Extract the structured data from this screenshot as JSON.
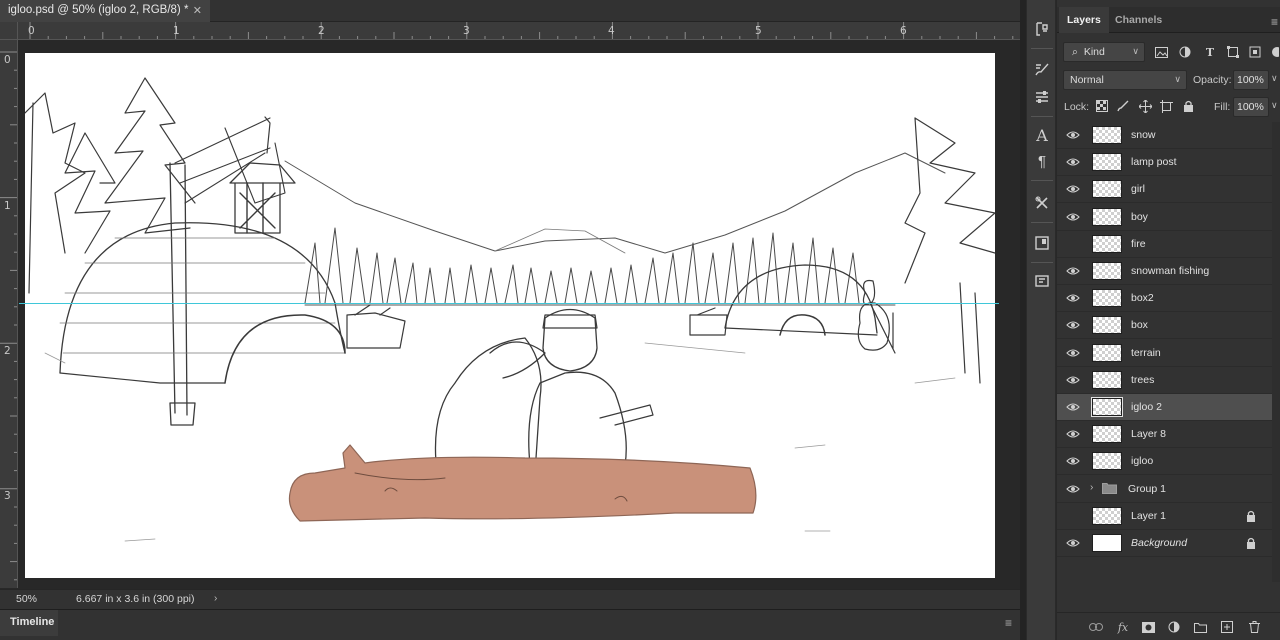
{
  "document": {
    "tab_title": "igloo.psd @ 50% (igloo 2, RGB/8) *",
    "close_glyph": "✕"
  },
  "rulers": {
    "horizontal": [
      "0",
      "1",
      "2",
      "3",
      "4",
      "5",
      "6"
    ],
    "vertical": [
      "0",
      "1",
      "2",
      "3"
    ]
  },
  "status": {
    "zoom": "50%",
    "doc_info": "6.667 in x 3.6 in (300 ppi)",
    "arrow": "›"
  },
  "timeline": {
    "label": "Timeline",
    "menu_glyph": "≡"
  },
  "layers_panel": {
    "tabs": [
      "Layers",
      "Channels"
    ],
    "filter_kind": "Kind",
    "blend_mode": "Normal",
    "opacity_label": "Opacity:",
    "opacity_value": "100%",
    "lock_label": "Lock:",
    "fill_label": "Fill:",
    "fill_value": "100%",
    "layers": [
      {
        "name": "snow",
        "visible": true,
        "type": "layer"
      },
      {
        "name": "lamp post",
        "visible": true,
        "type": "layer"
      },
      {
        "name": "girl",
        "visible": true,
        "type": "layer"
      },
      {
        "name": "boy",
        "visible": true,
        "type": "layer"
      },
      {
        "name": "fire",
        "visible": false,
        "type": "layer"
      },
      {
        "name": "snowman fishing",
        "visible": true,
        "type": "layer"
      },
      {
        "name": "box2",
        "visible": true,
        "type": "layer"
      },
      {
        "name": "box",
        "visible": true,
        "type": "layer"
      },
      {
        "name": "terrain",
        "visible": true,
        "type": "layer"
      },
      {
        "name": "trees",
        "visible": true,
        "type": "layer"
      },
      {
        "name": "igloo 2",
        "visible": true,
        "type": "layer",
        "selected": true
      },
      {
        "name": "Layer 8",
        "visible": true,
        "type": "layer"
      },
      {
        "name": "igloo",
        "visible": true,
        "type": "layer"
      },
      {
        "name": "Group 1",
        "visible": true,
        "type": "group"
      },
      {
        "name": "Layer 1",
        "visible": false,
        "type": "layer",
        "locked": true
      },
      {
        "name": "Background",
        "visible": true,
        "type": "background",
        "locked": true
      }
    ]
  },
  "colors": {
    "guide": "#3fc7d9",
    "log_fill": "#c9917a",
    "selected_row": "#4f4f4f"
  }
}
